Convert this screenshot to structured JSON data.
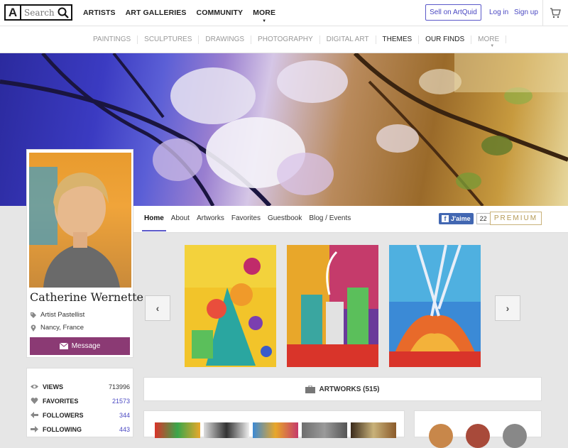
{
  "header": {
    "logo_letter": "A",
    "search_placeholder": "Search",
    "nav": [
      "ARTISTS",
      "ART GALLERIES",
      "COMMUNITY",
      "MORE"
    ],
    "sell_label": "Sell on ArtQuid",
    "login_label": "Log in",
    "signup_label": "Sign up"
  },
  "subnav": [
    "PAINTINGS",
    "SCULPTURES",
    "DRAWINGS",
    "PHOTOGRAPHY",
    "DIGITAL ART",
    "THEMES",
    "OUR FINDS",
    "MORE"
  ],
  "profile": {
    "name": "Catherine Wernette",
    "role": "Artist Pastellist",
    "location": "Nancy, France",
    "message_label": "Message"
  },
  "tabs": [
    "Home",
    "About",
    "Artworks",
    "Favorites",
    "Guestbook",
    "Blog / Events"
  ],
  "facebook": {
    "label": "J'aime",
    "count": "22"
  },
  "premium_label": "PREMIUM",
  "artworks_label": "ARTWORKS (515)",
  "stats": [
    {
      "label": "VIEWS",
      "value": "713996",
      "icon": "eye-icon"
    },
    {
      "label": "FAVORITES",
      "value": "21573",
      "icon": "heart-icon"
    },
    {
      "label": "FOLLOWERS",
      "value": "344",
      "icon": "arrow-left-icon"
    },
    {
      "label": "FOLLOWING",
      "value": "443",
      "icon": "arrow-right-icon"
    }
  ],
  "colors": {
    "accent": "#5b59c9",
    "message_button": "#8b3a74",
    "premium": "#b59a55",
    "facebook": "#4267b2"
  }
}
